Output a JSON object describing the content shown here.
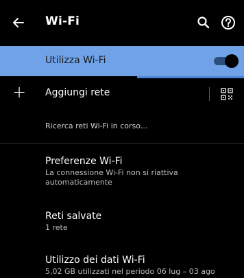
{
  "appbar": {
    "title": "Wi-Fi",
    "back_icon": "arrow-back-icon",
    "search_icon": "search-icon",
    "help_icon": "help-icon"
  },
  "wifi_toggle": {
    "label": "Utilizza Wi-Fi",
    "enabled": true,
    "accent": "#6fa2e6"
  },
  "add_network": {
    "label": "Aggiungi rete",
    "plus_icon": "plus-icon",
    "qr_icon": "qr-scan-icon"
  },
  "status": {
    "scanning": "Ricerca reti Wi-Fi in corso..."
  },
  "settings": [
    {
      "title": "Preferenze Wi-Fi",
      "summary": "La connessione Wi-Fi non si riattiva automaticamente"
    },
    {
      "title": "Reti salvate",
      "summary": "1 rete"
    },
    {
      "title": "Utilizzo dei dati Wi-Fi",
      "summary": "5,02 GB utilizzati nel periodo 06 lug – 03 ago"
    }
  ]
}
